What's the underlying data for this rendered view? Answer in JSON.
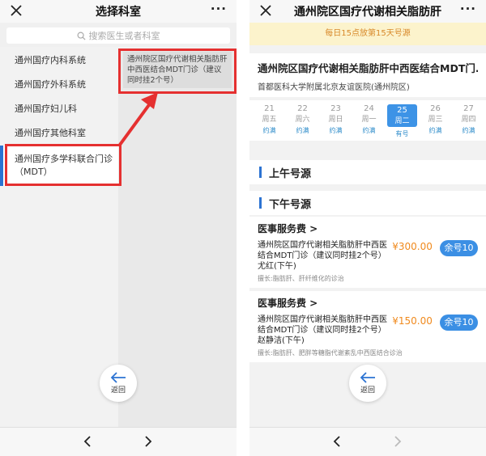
{
  "left": {
    "title": "选择科室",
    "more": "···",
    "search_placeholder": "搜索医生或者科室",
    "departments": [
      {
        "label": "通州国疗内科系统"
      },
      {
        "label": "通州国疗外科系统"
      },
      {
        "label": "通州国疗妇儿科"
      },
      {
        "label": "通州国疗其他科室"
      },
      {
        "label": "通州国疗多学科联合门诊（MDT）"
      }
    ],
    "sub_items": [
      {
        "label": "通州院区国疗代谢相关脂肪肝中西医结合MDT门诊（建议同时挂2个号）"
      }
    ],
    "back_label": "返回"
  },
  "right": {
    "title": "通州院区国疗代谢相关脂肪肝",
    "more": "···",
    "notice": "每日15点放第15天号源",
    "hospital_name": "通州院区国疗代谢相关脂肪肝中西医结合MDT门...",
    "hospital_sub": "首都医科大学附属北京友谊医院(通州院区)",
    "dates": [
      {
        "day": "21",
        "week": "周五",
        "status": "约满"
      },
      {
        "day": "22",
        "week": "周六",
        "status": "约满"
      },
      {
        "day": "23",
        "week": "周日",
        "status": "约满"
      },
      {
        "day": "24",
        "week": "周一",
        "status": "约满"
      },
      {
        "day": "25",
        "week": "周二",
        "status": "有号"
      },
      {
        "day": "26",
        "week": "周三",
        "status": "约满"
      },
      {
        "day": "27",
        "week": "周四",
        "status": "约满"
      }
    ],
    "morning_title": "上午号源",
    "afternoon_title": "下午号源",
    "slots": [
      {
        "fee": "医事服务费 >",
        "desc": "通州院区国疗代谢相关脂肪肝中西医结合MDT门诊（建议同时挂2个号）尤红(下午)",
        "price": "¥300.00",
        "remain": "余号10",
        "skill": "擅长:脂肪肝、肝纤维化的诊治"
      },
      {
        "fee": "医事服务费 >",
        "desc": "通州院区国疗代谢相关脂肪肝中西医结合MDT门诊（建议同时挂2个号）赵静洁(下午)",
        "price": "¥150.00",
        "remain": "余号10",
        "skill": "擅长:脂肪肝、肥胖等糖脂代谢紊乱中西医结合诊治"
      }
    ],
    "back_label": "返回"
  },
  "colors": {
    "accent_blue": "#3b8fe4",
    "highlight_red": "#e53030",
    "notice_bg": "#fcf3cc",
    "price_orange": "#f08a1e"
  }
}
